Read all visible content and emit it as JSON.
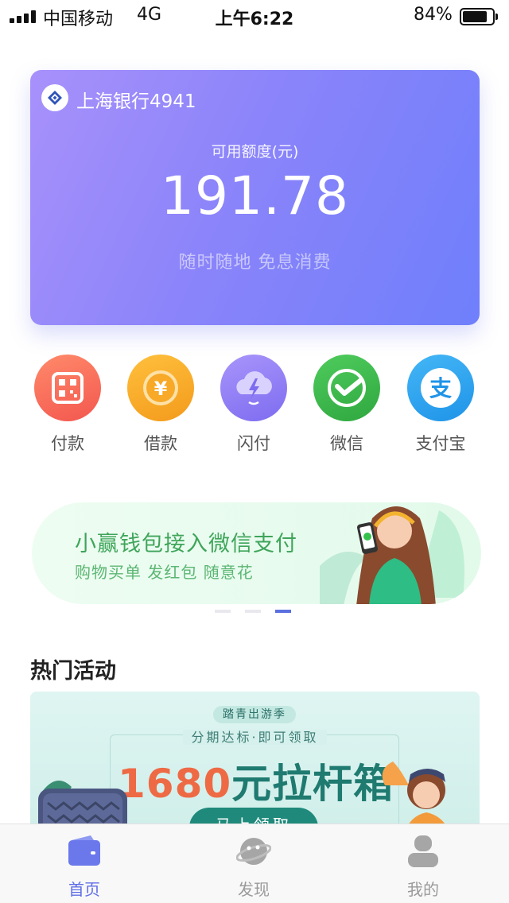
{
  "status_bar": {
    "carrier": "中国移动",
    "network": "4G",
    "time": "上午6:22",
    "battery": "84%"
  },
  "card": {
    "bank_name": "上海银行4941",
    "limit_label": "可用额度(元)",
    "amount": "191.78",
    "slogan": "随时随地 免息消费"
  },
  "quick_actions": [
    {
      "label": "付款",
      "icon": "qr-code-icon",
      "color": "#f6655a"
    },
    {
      "label": "借款",
      "icon": "yen-coin-icon",
      "color": "#f6a623"
    },
    {
      "label": "闪付",
      "icon": "cloud-lightning-icon",
      "color": "#8f79f5"
    },
    {
      "label": "微信",
      "icon": "wechat-check-icon",
      "color": "#3bb54a"
    },
    {
      "label": "支付宝",
      "icon": "alipay-icon",
      "color": "#2aa1ef"
    }
  ],
  "banner": {
    "title": "小赢钱包接入微信支付",
    "subtitle": "购物买单  发红包  随意花",
    "page_count": 3,
    "active_page": 3
  },
  "section": {
    "title": "热门活动"
  },
  "promo": {
    "badge": "踏青出游季",
    "subtitle": "分期达标·即可领取",
    "amount": "1680",
    "prize": "元拉杆箱",
    "button": "马上领取"
  },
  "tab_bar": [
    {
      "label": "首页",
      "icon": "wallet-icon",
      "active": true
    },
    {
      "label": "发现",
      "icon": "planet-icon",
      "active": false
    },
    {
      "label": "我的",
      "icon": "user-icon",
      "active": false
    }
  ],
  "colors": {
    "accent": "#5f6ee6",
    "card_gradient_start": "#a891fb",
    "card_gradient_end": "#6f7ffb",
    "banner_green": "#3fa55a"
  }
}
